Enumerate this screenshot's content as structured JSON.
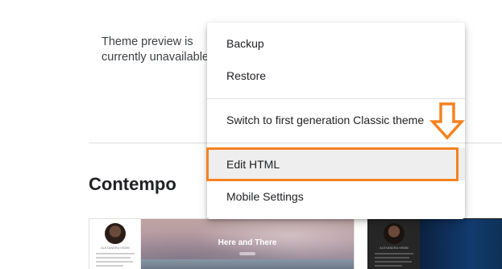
{
  "preview": {
    "message": "Theme preview is currently unavailable."
  },
  "section": {
    "title": "Contempo"
  },
  "themes": [
    {
      "profile_name": "ALEXANDRA HEMM",
      "hero_title": "Here and There"
    },
    {
      "profile_name": "ALEXANDRA HEMM"
    }
  ],
  "menu": {
    "items": [
      {
        "label": "Backup"
      },
      {
        "label": "Restore"
      },
      {
        "label": "Switch to first generation Classic theme"
      },
      {
        "label": "Edit HTML"
      },
      {
        "label": "Mobile Settings"
      }
    ]
  },
  "annotation": {
    "color": "#f58220"
  }
}
